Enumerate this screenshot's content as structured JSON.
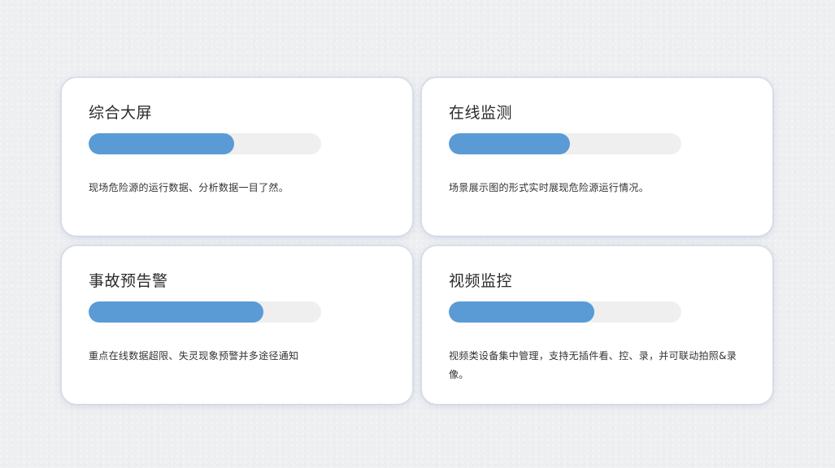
{
  "cards": [
    {
      "title": "综合大屏",
      "progress": 0.625,
      "description": "现场危险源的运行数据、分析数据一目了然。"
    },
    {
      "title": "在线监测",
      "progress": 0.52,
      "description": "场景展示图的形式实时展现危险源运行情况。"
    },
    {
      "title": "事故预告警",
      "progress": 0.75,
      "description": "重点在线数据超限、失灵现象预警并多途径通知"
    },
    {
      "title": "视频监控",
      "progress": 0.625,
      "description": "视频类设备集中管理，支持无插件看、控、录，并可联动拍照&录像。"
    }
  ],
  "colors": {
    "progress_fill": "#5b9bd5",
    "progress_track": "#efefef",
    "card_background": "#ffffff",
    "page_background": "#eeeff1"
  }
}
